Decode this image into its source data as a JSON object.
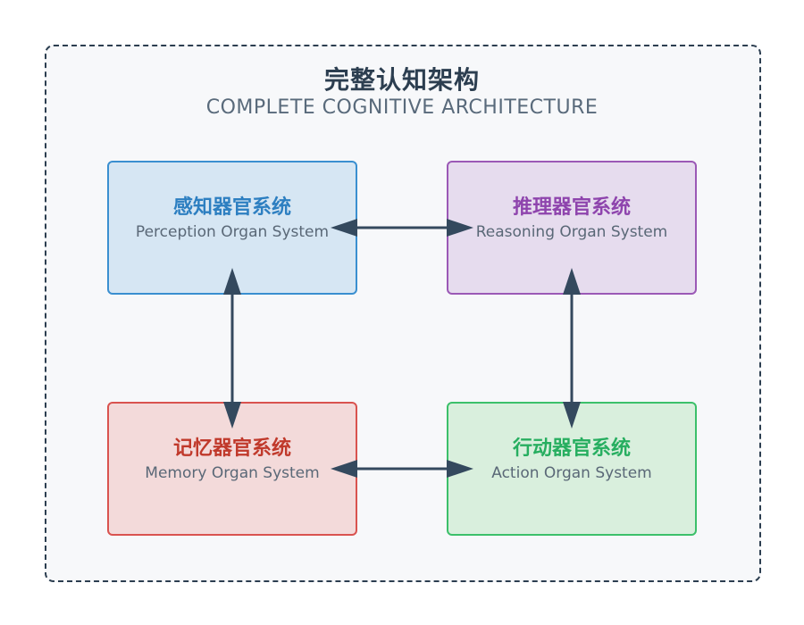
{
  "title": "完整认知架构",
  "subtitle": "COMPLETE COGNITIVE ARCHITECTURE",
  "boxes": {
    "perception": {
      "zh": "感知器官系统",
      "en": "Perception Organ System",
      "color": "#2d7fc1"
    },
    "reasoning": {
      "zh": "推理器官系统",
      "en": "Reasoning Organ System",
      "color": "#8e44ad"
    },
    "memory": {
      "zh": "记忆器官系统",
      "en": "Memory Organ System",
      "color": "#c0392b"
    },
    "action": {
      "zh": "行动器官系统",
      "en": "Action Organ System",
      "color": "#27ae60"
    }
  },
  "connections": [
    {
      "from": "perception",
      "to": "reasoning",
      "bidirectional": true
    },
    {
      "from": "perception",
      "to": "memory",
      "bidirectional": true
    },
    {
      "from": "reasoning",
      "to": "action",
      "bidirectional": true
    },
    {
      "from": "memory",
      "to": "action",
      "bidirectional": true
    }
  ],
  "arrow_color": "#34495e"
}
